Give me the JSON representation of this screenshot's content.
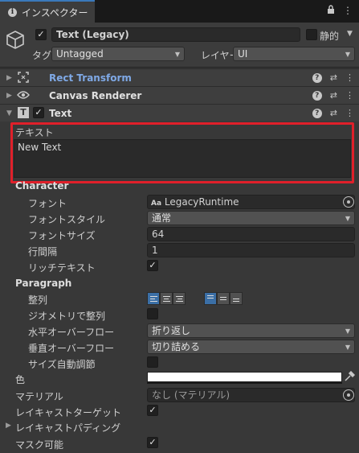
{
  "tab": {
    "title": "インスペクター",
    "lock_icon": "lock-icon",
    "menu_icon": "more-vert-icon"
  },
  "header": {
    "object_name": "Text (Legacy)",
    "active": true,
    "static_label": "静的",
    "tag_label": "タグ",
    "tag_value": "Untagged",
    "layer_label": "レイヤー",
    "layer_value": "UI"
  },
  "components": [
    {
      "name": "Rect Transform",
      "icon": "rect-transform-icon",
      "highlight_color": "#7fa9e6"
    },
    {
      "name": "Canvas Renderer",
      "icon": "eye-icon"
    },
    {
      "name": "Text",
      "icon": "text-icon",
      "enabled": true
    }
  ],
  "text_component": {
    "text_label": "テキスト",
    "text_value": "New Text",
    "character_header": "Character",
    "font_label": "フォント",
    "font_value": "LegacyRuntime",
    "font_prefix": "Aa",
    "font_style_label": "フォントスタイル",
    "font_style_value": "通常",
    "font_size_label": "フォントサイズ",
    "font_size_value": "64",
    "line_spacing_label": "行間隔",
    "line_spacing_value": "1",
    "rich_text_label": "リッチテキスト",
    "rich_text": true,
    "paragraph_header": "Paragraph",
    "alignment_label": "整列",
    "align_geometry_label": "ジオメトリで整列",
    "align_geometry": false,
    "h_overflow_label": "水平オーバーフロー",
    "h_overflow_value": "折り返し",
    "v_overflow_label": "垂直オーバーフロー",
    "v_overflow_value": "切り詰める",
    "best_fit_label": "サイズ自動調節",
    "best_fit": false,
    "color_label": "色",
    "color_value": "#ffffff",
    "material_label": "マテリアル",
    "material_value": "なし (マテリアル)",
    "raycast_target_label": "レイキャストターゲット",
    "raycast_target": true,
    "raycast_padding_label": "レイキャストパディング",
    "maskable_label": "マスク可能",
    "maskable": true
  },
  "colors": {
    "highlight_border": "#e0202a",
    "accent": "#3a79bb",
    "rect_transform_label": "#7fa9e6"
  }
}
